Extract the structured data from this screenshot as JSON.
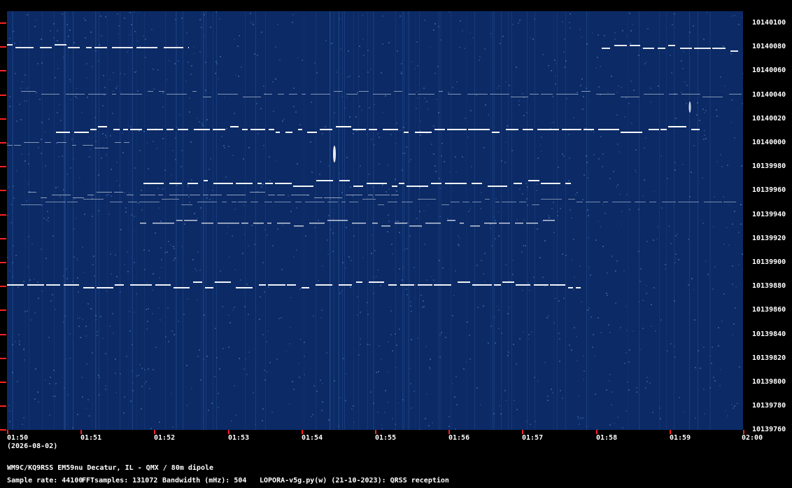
{
  "chart_data": {
    "type": "heatmap",
    "date_label": "(2026-08-02)",
    "x_ticks": [
      "01:50",
      "01:51",
      "01:52",
      "01:53",
      "01:54",
      "01:55",
      "01:56",
      "01:57",
      "01:58",
      "01:59",
      "02:00"
    ],
    "y_ticks": [
      10140100,
      10140080,
      10140060,
      10140040,
      10140020,
      10140000,
      10139980,
      10139960,
      10139940,
      10139920,
      10139900,
      10139880,
      10139860,
      10139840,
      10139820,
      10139800,
      10139780,
      10139760
    ],
    "xlim": [
      "01:50",
      "02:00"
    ],
    "ylim": [
      10139750,
      10140108
    ],
    "colors": {
      "background": "#0b2a66",
      "signal": "#ffffff",
      "tick": "#ff2020"
    }
  },
  "footer": {
    "station": "WM9C/KQ9RSS EM59nu Decatur, IL - QMX / 80m dipole",
    "sample_rate": "Sample rate: 44100",
    "fft_samples": "FFTsamples: 131072",
    "bandwidth": "Bandwidth (mHz): 504",
    "software": "LOPORA-v5g.py(w) (21-10-2023): QRSS reception"
  }
}
